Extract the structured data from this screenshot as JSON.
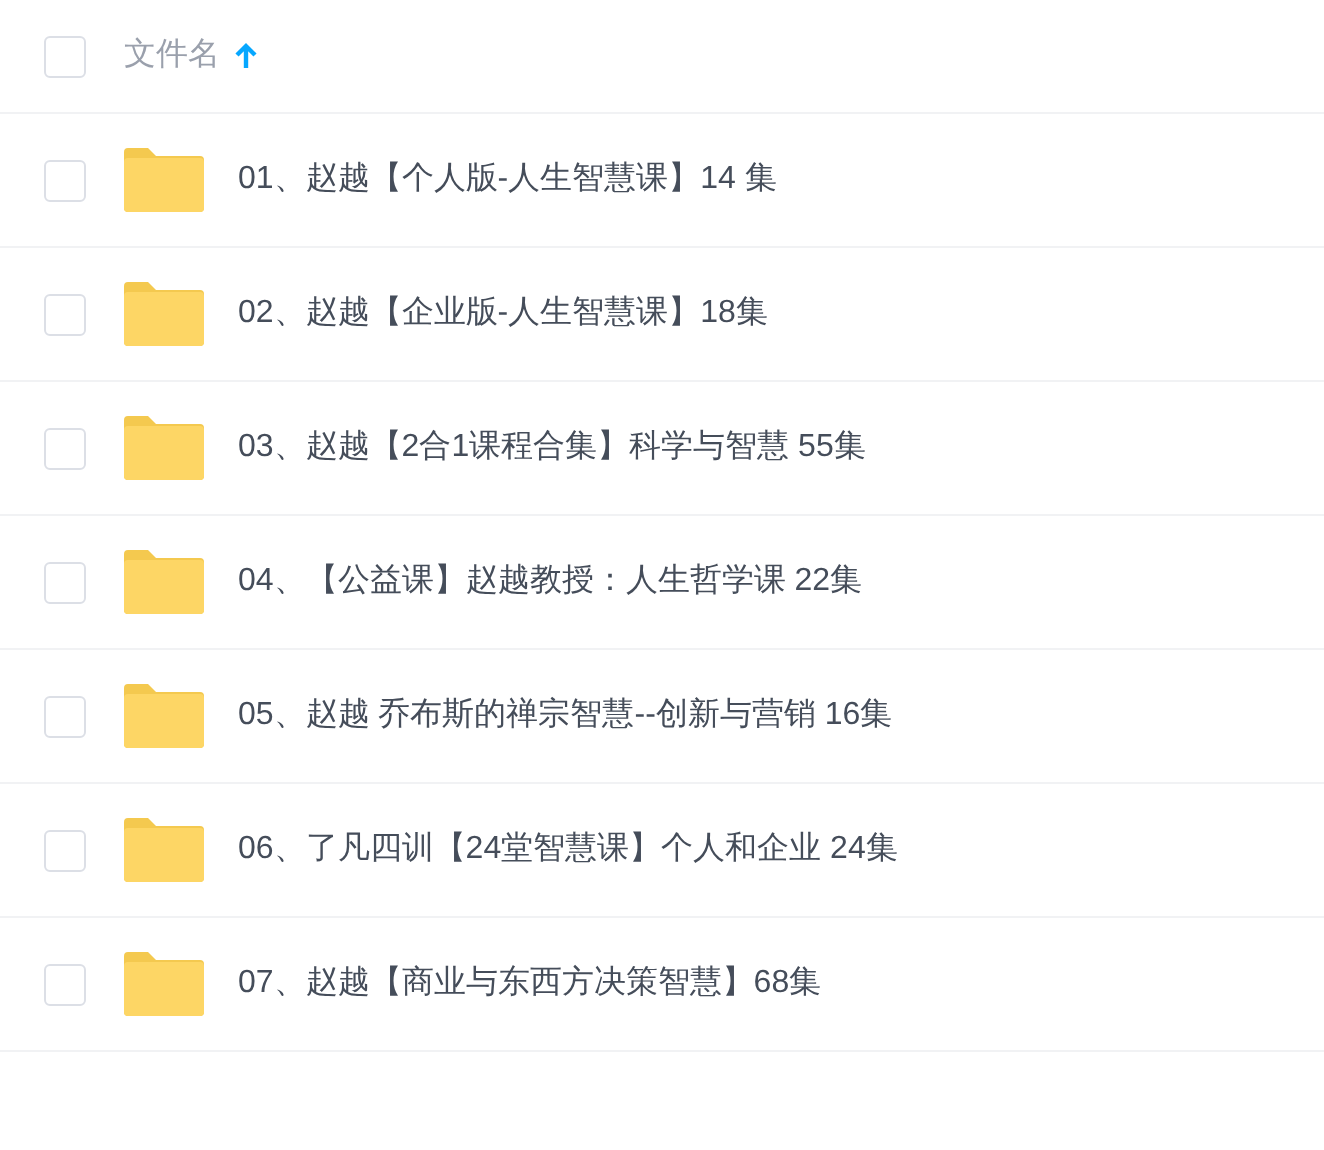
{
  "header": {
    "label": "文件名",
    "checked": false,
    "sort_ascending": true
  },
  "rows": [
    {
      "name": "01、赵越【个人版-人生智慧课】14 集",
      "checked": false
    },
    {
      "name": "02、赵越【企业版-人生智慧课】18集",
      "checked": false
    },
    {
      "name": "03、赵越【2合1课程合集】科学与智慧 55集",
      "checked": false
    },
    {
      "name": "04、【公益课】赵越教授：人生哲学课 22集",
      "checked": false
    },
    {
      "name": "05、赵越 乔布斯的禅宗智慧--创新与营销 16集",
      "checked": false
    },
    {
      "name": "06、了凡四训【24堂智慧课】个人和企业 24集",
      "checked": false
    },
    {
      "name": "07、赵越【商业与东西方决策智慧】68集",
      "checked": false
    }
  ]
}
